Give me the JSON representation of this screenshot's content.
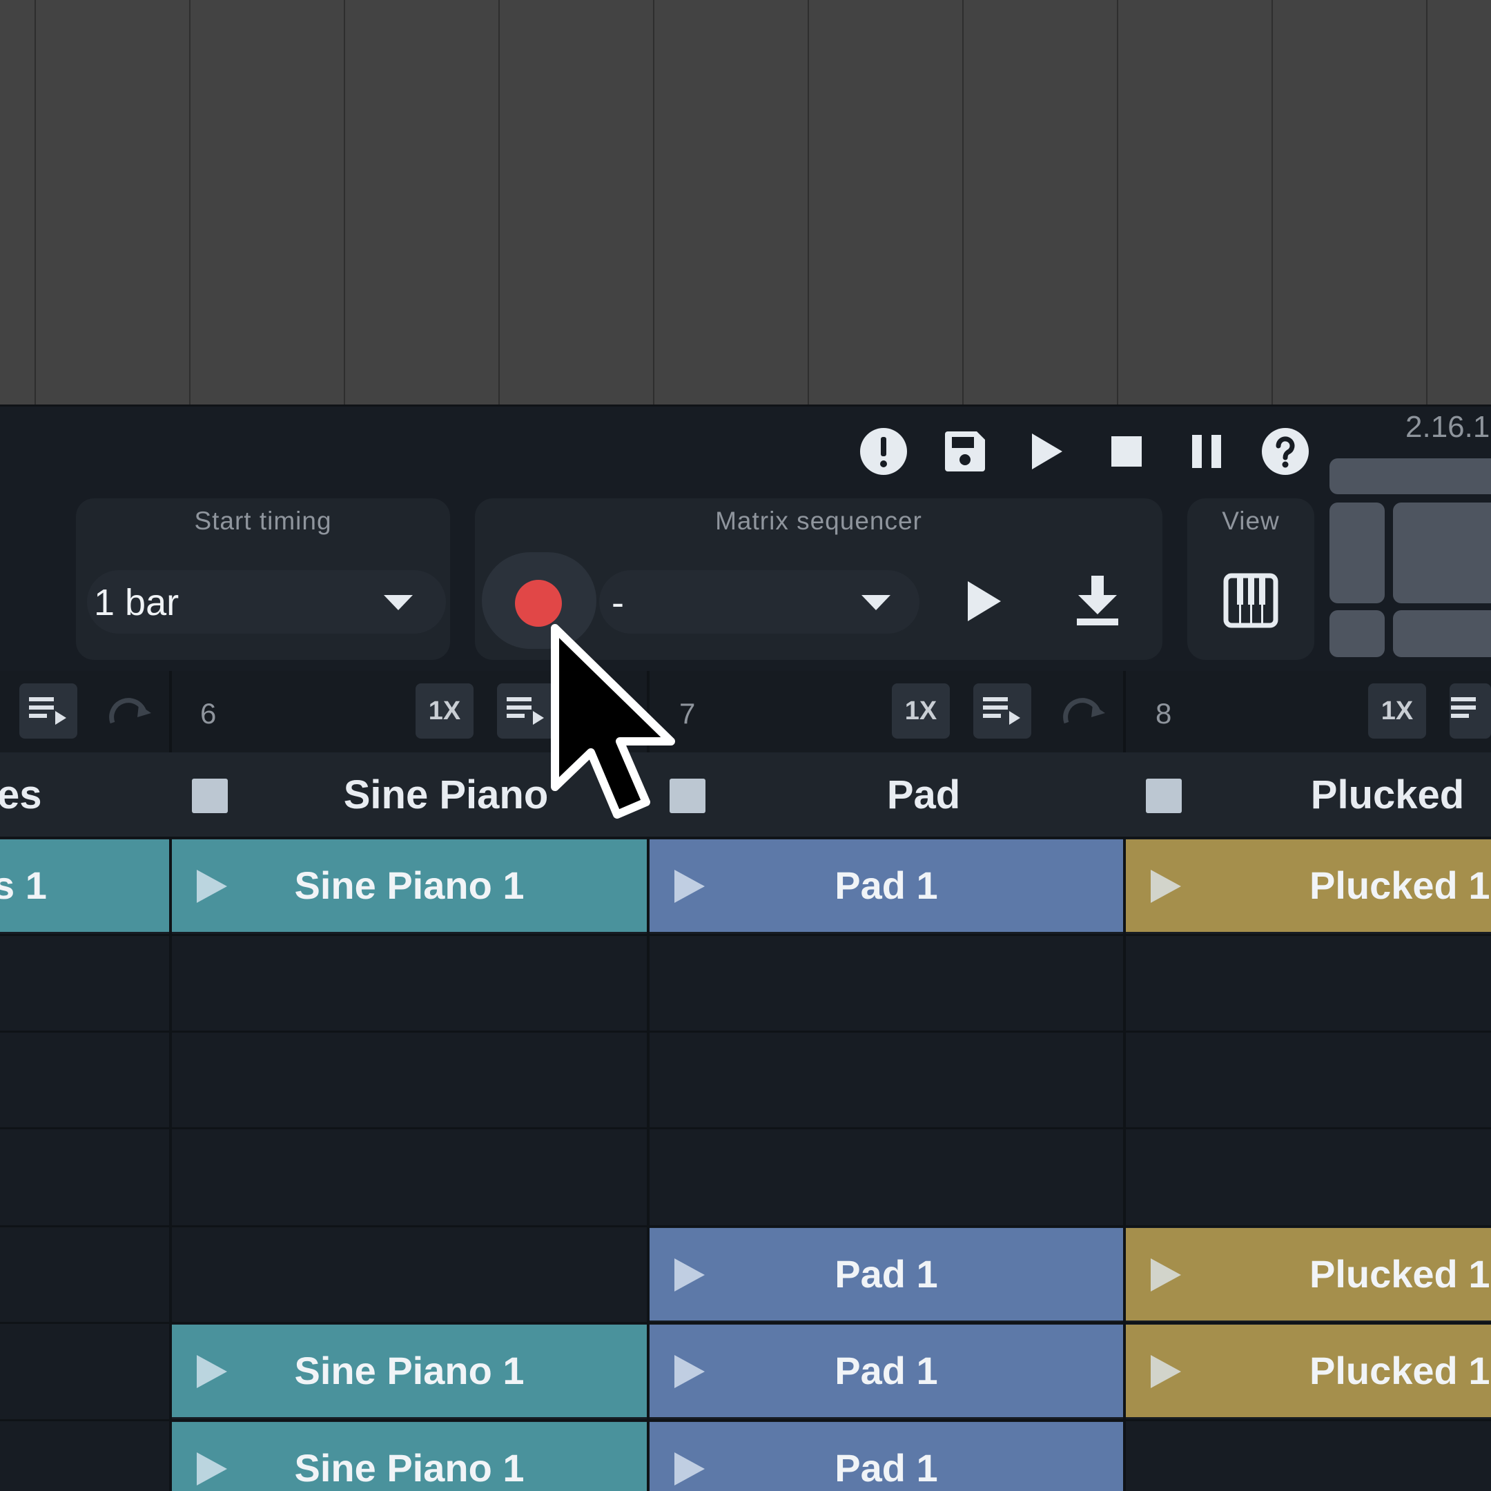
{
  "version": "2.16.1",
  "toolbar": {
    "icons": [
      "alert-icon",
      "save-icon",
      "play-icon",
      "stop-icon",
      "pause-icon",
      "help-icon"
    ]
  },
  "start_timing": {
    "title": "Start timing",
    "value": "1 bar"
  },
  "matrix_sequencer": {
    "title": "Matrix sequencer",
    "value": "-"
  },
  "view": {
    "title": "View"
  },
  "channels": [
    {
      "number": "",
      "name": "es",
      "label_1x": ""
    },
    {
      "number": "6",
      "name": "Sine Piano",
      "label_1x": "1X"
    },
    {
      "number": "7",
      "name": "Pad",
      "label_1x": "1X"
    },
    {
      "number": "8",
      "name": "Plucked",
      "label_1x": "1X"
    }
  ],
  "clips": {
    "row1": {
      "c5": "s 1",
      "c6": "Sine Piano 1",
      "c7": "Pad 1",
      "c8": "Plucked 1"
    },
    "row5": {
      "c7": "Pad 1",
      "c8": "Plucked 1"
    },
    "row6": {
      "c6": "Sine Piano 1",
      "c7": "Pad 1",
      "c8": "Plucked 1"
    },
    "row7": {
      "c6": "Sine Piano 1",
      "c7": "Pad 1"
    }
  },
  "colors": {
    "teal": "#4a929c",
    "blue": "#5d79a8",
    "gold": "#a58f4c",
    "record": "#e14747"
  }
}
